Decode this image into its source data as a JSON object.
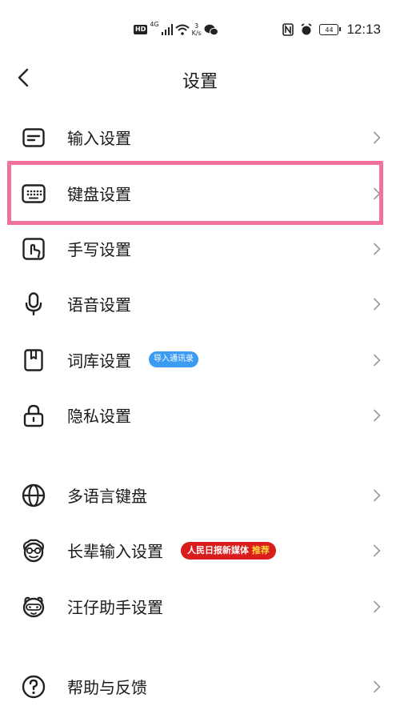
{
  "status_bar": {
    "hd": "HD",
    "network": "4G",
    "speed_value": "3",
    "speed_unit": "K/s",
    "battery": "44",
    "time": "12:13"
  },
  "header": {
    "title": "设置"
  },
  "settings": {
    "input": "输入设置",
    "keyboard": "键盘设置",
    "handwriting": "手写设置",
    "voice": "语音设置",
    "lexicon": "词库设置",
    "lexicon_badge": "导入通讯录",
    "privacy": "隐私设置",
    "multilang": "多语言键盘",
    "elder": "长辈输入设置",
    "elder_badge_main": "人民日报新媒体",
    "elder_badge_accent": "推荐",
    "assistant": "汪仔助手设置",
    "help": "帮助与反馈"
  },
  "colors": {
    "highlight": "#f0729b",
    "badge_blue": "#3c9cf4",
    "badge_red": "#d91c1c",
    "badge_red_accent": "#ffd43b"
  }
}
